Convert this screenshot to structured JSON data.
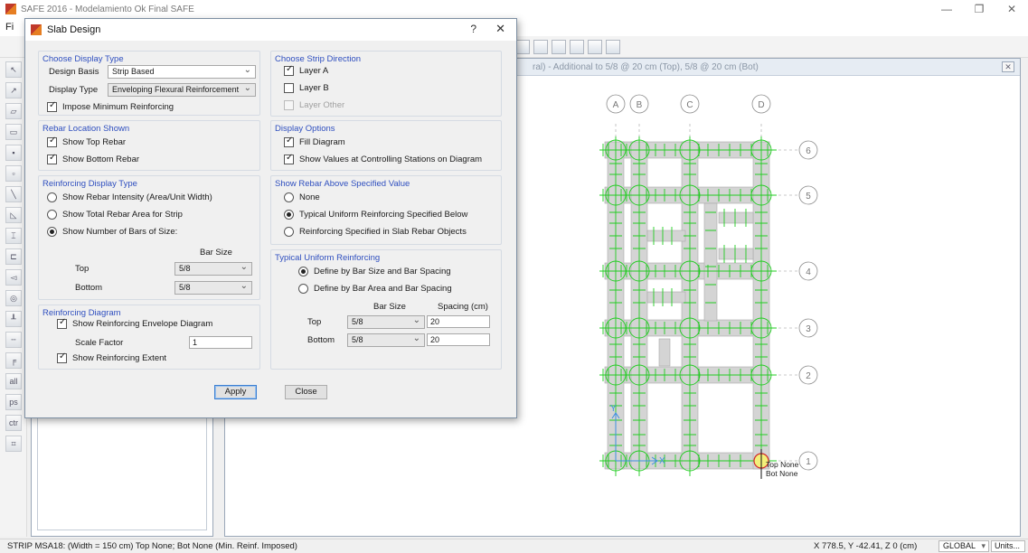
{
  "app": {
    "title": "SAFE 2016 - Modelamiento Ok Final SAFE",
    "menu_first": "Fi",
    "canvas_title": "ral) - Additional to 5/8 @ 20 cm (Top), 5/8 @ 20 cm (Bot)",
    "left_tool_labels": [
      "all",
      "ps",
      "ctr"
    ]
  },
  "dialog": {
    "title": "Slab Design",
    "help": "?",
    "close": "✕",
    "display_type": {
      "title": "Choose Display Type",
      "design_basis_label": "Design Basis",
      "design_basis_value": "Strip Based",
      "display_type_label": "Display Type",
      "display_type_value": "Enveloping Flexural Reinforcement",
      "impose_min_label": "Impose Minimum Reinforcing"
    },
    "rebar_location": {
      "title": "Rebar Location Shown",
      "top_label": "Show Top Rebar",
      "bottom_label": "Show Bottom Rebar"
    },
    "reinforcing_display": {
      "title": "Reinforcing Display Type",
      "opt1": "Show Rebar Intensity (Area/Unit Width)",
      "opt2": "Show Total Rebar Area for Strip",
      "opt3": "Show Number of Bars of Size:",
      "bar_size_header": "Bar Size",
      "top_label": "Top",
      "top_value": "5/8",
      "bottom_label": "Bottom",
      "bottom_value": "5/8"
    },
    "reinforcing_diagram": {
      "title": "Reinforcing Diagram",
      "envelope_label": "Show Reinforcing Envelope Diagram",
      "scale_label": "Scale Factor",
      "scale_value": "1",
      "extent_label": "Show Reinforcing Extent"
    },
    "strip_direction": {
      "title": "Choose Strip Direction",
      "layer_a": "Layer A",
      "layer_b": "Layer B",
      "layer_other": "Layer Other"
    },
    "display_options": {
      "title": "Display Options",
      "fill_label": "Fill Diagram",
      "values_label": "Show Values at Controlling Stations on Diagram"
    },
    "show_rebar_above": {
      "title": "Show Rebar Above Specified Value",
      "none": "None",
      "typical": "Typical Uniform Reinforcing Specified Below",
      "slab_objects": "Reinforcing Specified in Slab Rebar Objects"
    },
    "typical_uniform": {
      "title": "Typical Uniform Reinforcing",
      "opt1": "Define by Bar Size and Bar Spacing",
      "opt2": "Define by Bar Area and Bar Spacing",
      "bar_size_header": "Bar Size",
      "spacing_header": "Spacing  (cm)",
      "top_label": "Top",
      "top_size": "5/8",
      "top_spacing": "20",
      "bottom_label": "Bottom",
      "bottom_size": "5/8",
      "bottom_spacing": "20"
    },
    "apply": "Apply",
    "close_button": "Close"
  },
  "plan": {
    "grid_x": [
      "A",
      "B",
      "C",
      "D"
    ],
    "grid_y": [
      "6",
      "5",
      "4",
      "3",
      "2",
      "1"
    ],
    "annot_top": "Top None",
    "annot_bot": "Bot None",
    "axis_y": "Y",
    "axis_x": "X"
  },
  "status": {
    "left": "STRIP MSA18:  (Width = 150 cm)  Top None; Bot None  (Min. Reinf. Imposed)",
    "coords": "X 778.5,  Y -42.41,  Z 0  (cm)",
    "coord_system": "GLOBAL",
    "units": "Units..."
  }
}
